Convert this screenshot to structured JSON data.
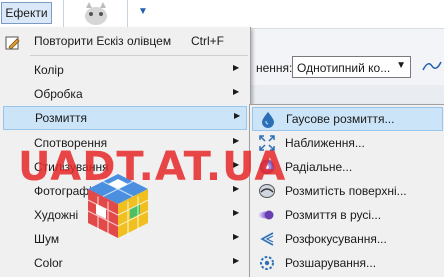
{
  "app": {
    "menu_button": "Ефекти",
    "blend_label_partial": "нення:",
    "blend_select_value": "Однотипний ко..."
  },
  "main_menu": {
    "items": [
      {
        "label": "Повторити Ескіз олівцем",
        "shortcut": "Ctrl+F",
        "icon": "pencil-sketch-icon"
      },
      {
        "label": "Колір"
      },
      {
        "label": "Обробка"
      },
      {
        "label": "Розмиття"
      },
      {
        "label": "Спотворення"
      },
      {
        "label": "Стилізування"
      },
      {
        "label": "Фотографія"
      },
      {
        "label": "Художні"
      },
      {
        "label": "Шум"
      },
      {
        "label": "Color"
      }
    ]
  },
  "sub_menu": {
    "items": [
      {
        "label": "Гаусове розмиття...",
        "icon": "droplet-icon"
      },
      {
        "label": "Наближення...",
        "icon": "zoom-blur-icon"
      },
      {
        "label": "Радіальне...",
        "icon": "radial-blur-icon"
      },
      {
        "label": "Розмитість поверхні...",
        "icon": "surface-blur-icon"
      },
      {
        "label": "Розмиття в русі...",
        "icon": "motion-blur-icon"
      },
      {
        "label": "Розфокусування...",
        "icon": "unfocus-icon"
      },
      {
        "label": "Розшарування...",
        "icon": "fragment-icon"
      }
    ]
  },
  "watermark": {
    "text": "UADT.AT.UA"
  },
  "colors": {
    "highlight": "#cce4f7",
    "menu_bg": "#f0f0f0",
    "watermark": "#e62828"
  }
}
